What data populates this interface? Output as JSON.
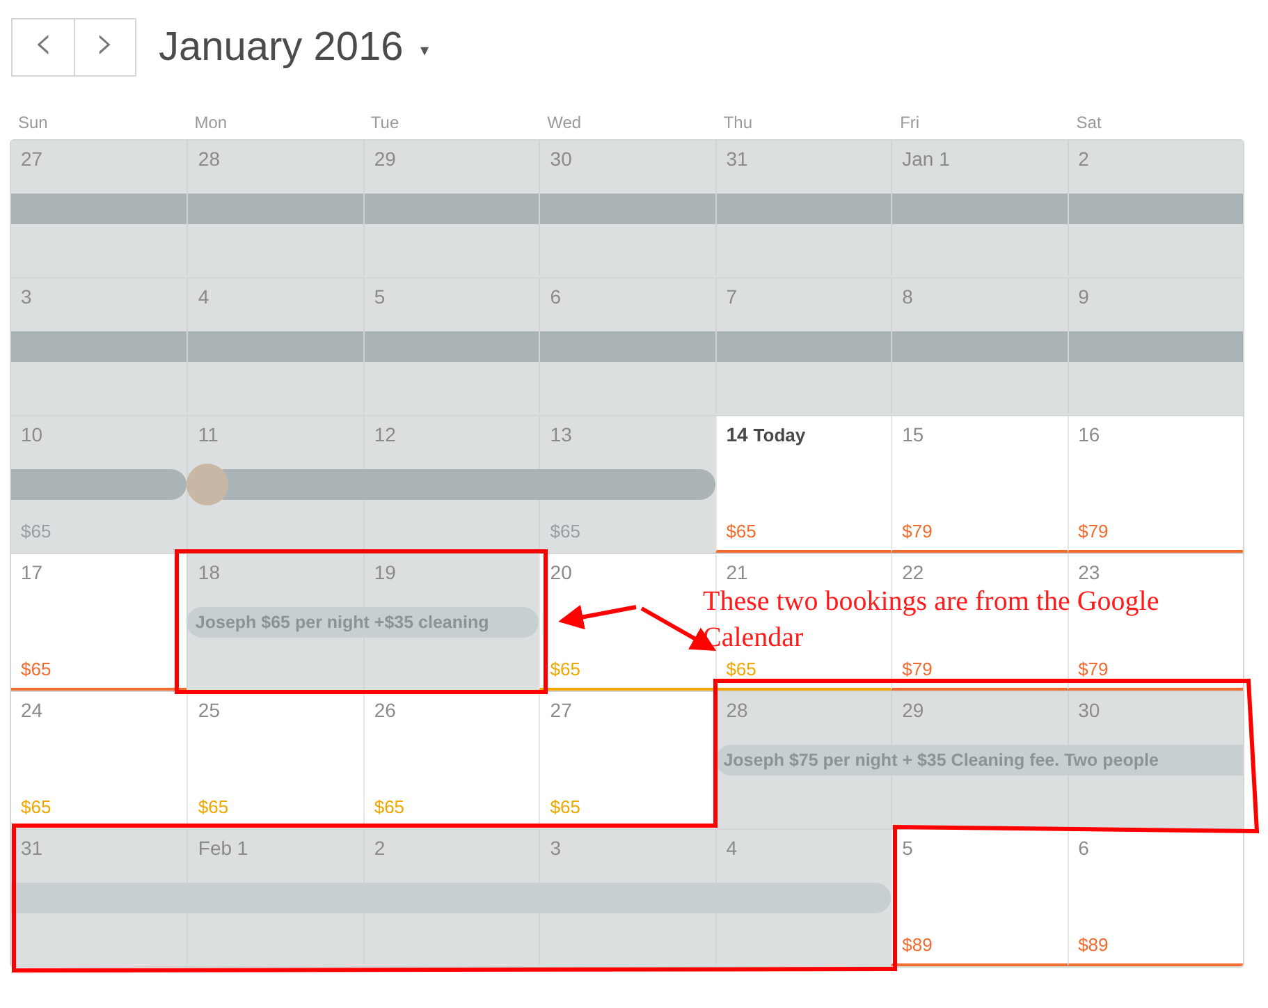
{
  "header": {
    "prev": "‹",
    "next": "›",
    "title": "January 2016",
    "caret": "▾"
  },
  "weekdays": [
    "Sun",
    "Mon",
    "Tue",
    "Wed",
    "Thu",
    "Fri",
    "Sat"
  ],
  "weeks": [
    {
      "days": [
        {
          "date": "27",
          "blocked": true,
          "bar": {
            "dark": true,
            "open_left": true,
            "open_right": true
          }
        },
        {
          "date": "28",
          "blocked": true,
          "in_bar": true
        },
        {
          "date": "29",
          "blocked": true,
          "in_bar": true
        },
        {
          "date": "30",
          "blocked": true,
          "in_bar": true
        },
        {
          "date": "31",
          "blocked": true,
          "in_bar": true
        },
        {
          "date": "Jan 1",
          "blocked": true,
          "in_bar": true
        },
        {
          "date": "2",
          "blocked": true,
          "in_bar": true
        }
      ]
    },
    {
      "days": [
        {
          "date": "3",
          "blocked": true,
          "bar": {
            "dark": true,
            "open_left": true,
            "open_right": true
          }
        },
        {
          "date": "4",
          "blocked": true,
          "in_bar": true
        },
        {
          "date": "5",
          "blocked": true,
          "in_bar": true
        },
        {
          "date": "6",
          "blocked": true,
          "in_bar": true
        },
        {
          "date": "7",
          "blocked": true,
          "in_bar": true
        },
        {
          "date": "8",
          "blocked": true,
          "in_bar": true
        },
        {
          "date": "9",
          "blocked": true,
          "in_bar": true
        }
      ]
    },
    {
      "days": [
        {
          "date": "10",
          "blocked": true,
          "price": "$65",
          "color": "#979ea0",
          "bar": {
            "dark": true,
            "open_left": true,
            "open_right": false
          }
        },
        {
          "date": "11",
          "blocked": true,
          "bar": {
            "dark": true,
            "open_left": false,
            "open_right": false,
            "avatar": true
          }
        },
        {
          "date": "12",
          "blocked": true,
          "in_bar": true
        },
        {
          "date": "13",
          "blocked": true,
          "price": "$65",
          "color": "#979ea0",
          "in_bar": true
        },
        {
          "date": "14",
          "today": true,
          "today_label": "Today",
          "price": "$65",
          "color": "#f26b2f",
          "underline": true
        },
        {
          "date": "15",
          "price": "$79",
          "color": "#f26b2f",
          "underline": true
        },
        {
          "date": "16",
          "price": "$79",
          "color": "#f26b2f",
          "underline": true
        }
      ]
    },
    {
      "days": [
        {
          "date": "17",
          "price": "$65",
          "color": "#f26b2f",
          "underline": true
        },
        {
          "date": "18",
          "blocked": true,
          "bar": {
            "dark": false,
            "open_left": false,
            "open_right": false,
            "text": "Joseph $65 per night +$35 cleaning"
          }
        },
        {
          "date": "19",
          "blocked": true,
          "in_bar": true
        },
        {
          "date": "20",
          "price": "$65",
          "color": "#f0a800",
          "underline": true
        },
        {
          "date": "21",
          "price": "$65",
          "color": "#f0a800",
          "underline": true
        },
        {
          "date": "22",
          "price": "$79",
          "color": "#f26b2f",
          "underline": true
        },
        {
          "date": "23",
          "price": "$79",
          "color": "#f26b2f",
          "underline": true
        }
      ]
    },
    {
      "days": [
        {
          "date": "24",
          "price": "$65",
          "color": "#f0a800"
        },
        {
          "date": "25",
          "price": "$65",
          "color": "#f0a800"
        },
        {
          "date": "26",
          "price": "$65",
          "color": "#f0a800"
        },
        {
          "date": "27",
          "price": "$65",
          "color": "#f0a800"
        },
        {
          "date": "28",
          "blocked": true,
          "bar": {
            "dark": false,
            "open_left": false,
            "open_right": true,
            "text": "Joseph $75 per night + $35 Cleaning fee. Two people"
          }
        },
        {
          "date": "29",
          "blocked": true,
          "in_bar": true
        },
        {
          "date": "30",
          "blocked": true,
          "in_bar": true
        }
      ]
    },
    {
      "days": [
        {
          "date": "31",
          "blocked": true,
          "bar": {
            "dark": false,
            "open_left": true,
            "open_right": false
          }
        },
        {
          "date": "Feb 1",
          "blocked": true,
          "in_bar": true
        },
        {
          "date": "2",
          "blocked": true,
          "in_bar": true
        },
        {
          "date": "3",
          "blocked": true,
          "in_bar": true
        },
        {
          "date": "4",
          "blocked": true,
          "in_bar": true
        },
        {
          "date": "5",
          "price": "$89",
          "color": "#f26b2f",
          "underline": true
        },
        {
          "date": "6",
          "price": "$89",
          "color": "#f26b2f",
          "underline": true
        }
      ]
    }
  ],
  "annotation": {
    "text": "These two bookings are from the Google Calendar"
  }
}
